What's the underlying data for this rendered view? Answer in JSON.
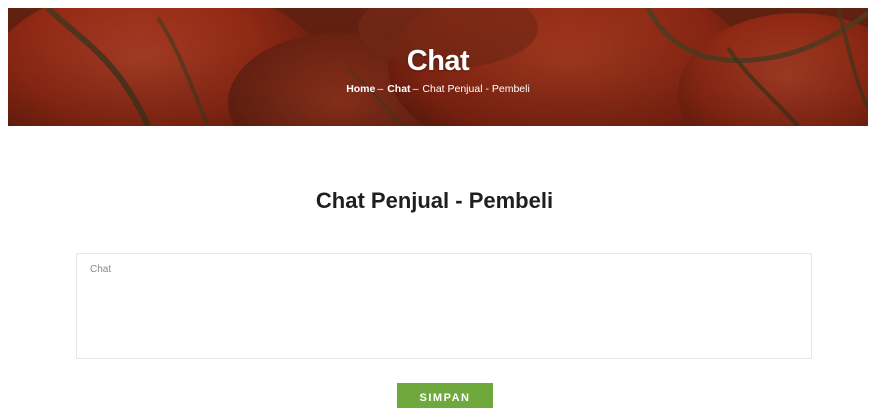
{
  "hero": {
    "title": "Chat",
    "breadcrumb": {
      "home": "Home",
      "sep1": "–",
      "chat": "Chat",
      "sep2": "–",
      "current": "Chat Penjual - Pembeli"
    }
  },
  "section": {
    "title": "Chat Penjual - Pembeli"
  },
  "form": {
    "chat_placeholder": "Chat",
    "submit_label": "SIMPAN"
  },
  "colors": {
    "button": "#6fa93e",
    "heading": "#1f1f1f",
    "hero_base": "#7a2a18"
  }
}
